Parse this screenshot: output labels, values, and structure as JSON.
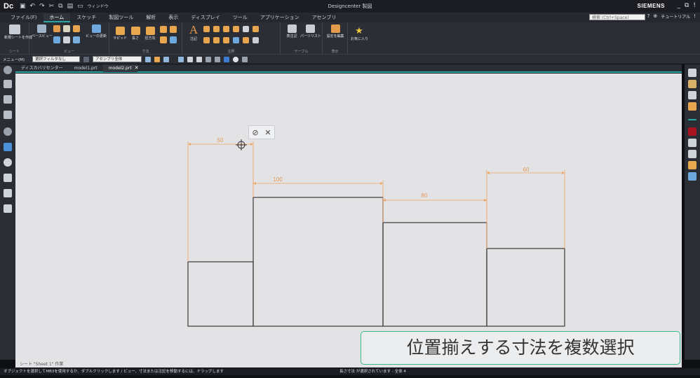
{
  "app": {
    "logo": "Dc",
    "title": "Designcenter 製図",
    "brand": "SIEMENS",
    "window_menu": "ウィンドウ",
    "window_controls": [
      "_",
      "⧉",
      "!"
    ]
  },
  "menu": {
    "tabs": [
      "ファイル(F)",
      "ホーム",
      "スケッチ",
      "製図ツール",
      "解析",
      "表示",
      "ディスプレイ",
      "ツール",
      "アプリケーション",
      "アセンブリ"
    ],
    "active_tab": "ホーム",
    "search_placeholder": "検索 (Ctrl+Space)",
    "tutorial": "チュートリアル"
  },
  "ribbon": {
    "new_sheet": "新規シートを作成",
    "base_view": "ベースビュー",
    "view_update": "ビューの更新",
    "rapid": "ラピッド",
    "length": "長さ",
    "radial": "径方向",
    "note": "注記",
    "table_note": "表注記",
    "parts_list": "パーツリスト",
    "edit_settings": "設定を編集",
    "favorites": "お気に入り",
    "groups": {
      "sheet": "シート",
      "view": "ビュー",
      "dimension": "寸法",
      "annotation": "注釈",
      "table": "テーブル",
      "display": "表示"
    }
  },
  "selection_bar": {
    "menu": "メニュー(M)",
    "filter": "選択フィルタなし",
    "scope": "アセンブリ全体"
  },
  "doc_tabs": [
    {
      "label": "ディスカバリセンター",
      "active": false
    },
    {
      "label": "model1.prt",
      "active": false
    },
    {
      "label": "model2.prt",
      "active": true
    }
  ],
  "drawing": {
    "dimensions": [
      "50",
      "100",
      "80",
      "60"
    ]
  },
  "sheet_label": "シート \"Sheet 1\" 作業",
  "status": {
    "left": "オブジェクトを選択してMB3を使用するか、ダブルクリックします / ビュー、寸法または注記を移動するには、ドラッグします",
    "center": "長さ寸法 が選択されています - 全体 4"
  },
  "caption": "位置揃えする寸法を複数選択",
  "colors": {
    "accent": "#2aa8a6",
    "dimension": "#f0a35e",
    "geometry": "#3a3a3a",
    "caption_border": "#39b88a"
  }
}
